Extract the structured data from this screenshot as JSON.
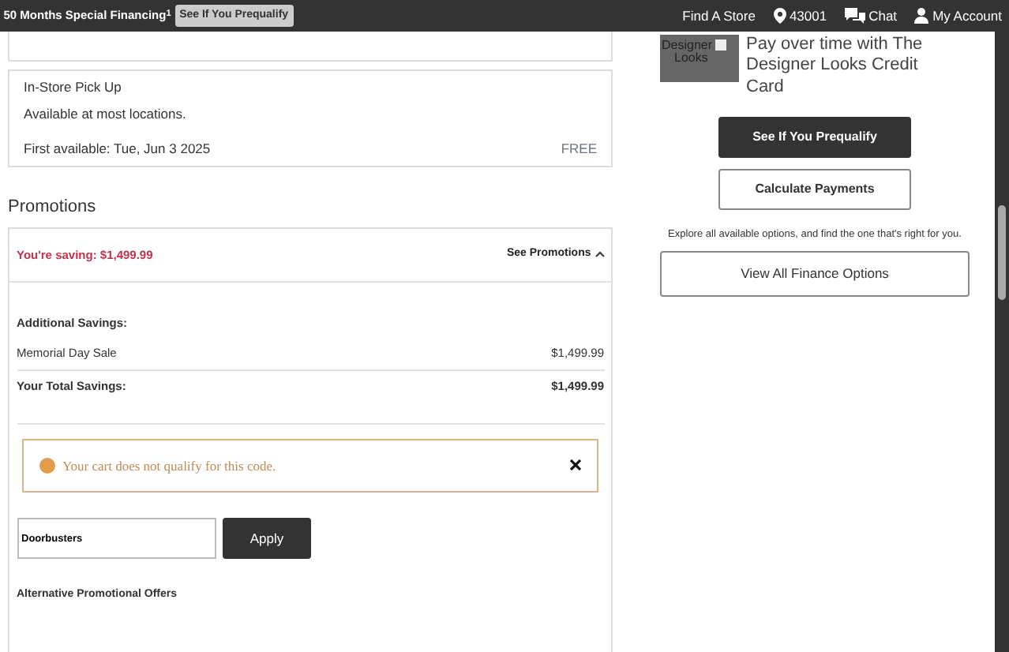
{
  "top_bar": {
    "promo": "50 Months Special Financing",
    "promo_mark": "1",
    "prequalify": "See If You Prequalify",
    "links": [
      {
        "kind": "store",
        "label": "Find A Store"
      },
      {
        "kind": "location",
        "label": "43001"
      },
      {
        "kind": "chat",
        "label": "Chat"
      },
      {
        "kind": "account",
        "label": "My Account"
      }
    ]
  },
  "pickup": {
    "title": "In-Store Pick Up",
    "availability": "Available at most locations.",
    "first_available": "First available: Tue, Jun 3 2025",
    "price": "FREE"
  },
  "promotions": {
    "heading": "Promotions",
    "saving": "You're saving: $1,499.99",
    "toggle": "See Promotions",
    "expanded": true,
    "additional_label": "Additional Savings:",
    "items": [
      {
        "name": "Memorial Day Sale",
        "amount": "$1,499.99"
      }
    ],
    "total_label": "Your Total Savings:",
    "total": "$1,499.99",
    "alert": "Your cart does not qualify for this code.",
    "code_value": "Doorbusters",
    "apply": "Apply",
    "alternative": "Alternative Promotional Offers"
  },
  "finance": {
    "card_brand": [
      "Designer",
      "Looks"
    ],
    "title": "Pay over time with The Designer Looks Credit Card",
    "prequalify": "See If You Prequalify",
    "calculate": "Calculate Payments",
    "explore": "Explore all available options, and find the one that's right for you.",
    "view_all": "View All Finance Options"
  }
}
